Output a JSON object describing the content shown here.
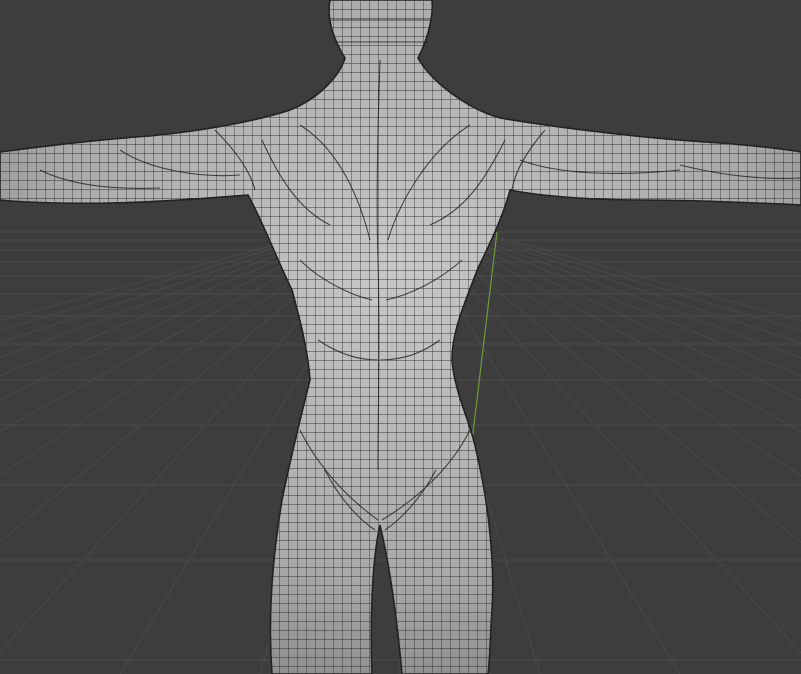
{
  "viewport": {
    "background_color": "#3d3d3d",
    "grid_color": "#4a4a4a",
    "axis_color": "#6f9a3a",
    "mesh_fill_color": "#b3b3b3",
    "mesh_wire_color": "#1f1f1f",
    "view_mode": "perspective",
    "shading": "solid-wireframe"
  },
  "scene": {
    "object": "human-body-mesh",
    "pose": "t-pose",
    "view": "back"
  }
}
